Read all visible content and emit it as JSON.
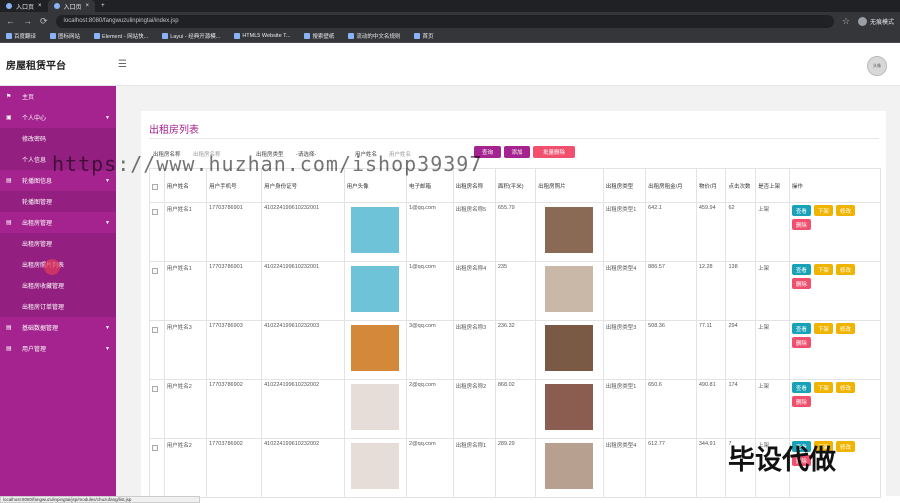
{
  "browser": {
    "tabs": [
      {
        "label": "入口页"
      },
      {
        "label": "入口页"
      }
    ],
    "url": "localhost:8080/fangwuzulinpingtai/index.jsp",
    "profile": "无痕模式",
    "bookmarks": [
      "百度翻译",
      "图标网站",
      "Element - 网站快...",
      "Layui - 经典开源模...",
      "HTML5 Website T...",
      "搜索壁纸",
      "流动的中文名规则",
      "首页"
    ]
  },
  "app": {
    "title": "房屋租赁平台",
    "avatar_label": "头像"
  },
  "sidebar": {
    "items": [
      {
        "label": "主页",
        "children": []
      },
      {
        "label": "个人中心",
        "children": [
          "修改密码",
          "个人信息"
        ]
      },
      {
        "label": "轮播图信息",
        "children": [
          "轮播图管理"
        ]
      },
      {
        "label": "出租房管理",
        "children": [
          "出租房管理",
          "出租房照片列表",
          "出租房收藏管理",
          "出租房订单管理"
        ]
      },
      {
        "label": "基础数据管理",
        "children": []
      },
      {
        "label": "用户管理",
        "children": []
      }
    ]
  },
  "page": {
    "title": "出租房列表"
  },
  "search": {
    "name_label": "出租房名称",
    "name_placeholder": "出租房名称",
    "type_label": "出租房类型",
    "type_value": "-请选择-",
    "user_label": "用户姓名",
    "user_placeholder": "用户姓名",
    "query_btn": "查询",
    "add_btn": "添加",
    "batch_delete_btn": "批量删除"
  },
  "table": {
    "headers": [
      "用户姓名",
      "用户手机号",
      "用户身份证号",
      "用户头像",
      "电子邮箱",
      "出租房名称",
      "面积(平米)",
      "出租房照片",
      "出租房类型",
      "出租房租金/月",
      "物价/月",
      "点击次数",
      "是否上架",
      "操作"
    ],
    "rows": [
      {
        "user": "用户姓名1",
        "phone": "17703786901",
        "idcard": "410224199610232001",
        "email": "1@qq.com",
        "house": "出租房名称5",
        "area": "655.79",
        "type": "出租房类型1",
        "rent": "642.1",
        "price": "459.94",
        "clicks": "62",
        "status": "上架",
        "avatar_color": "#6fc3d8",
        "photo_color": "#8a6a55"
      },
      {
        "user": "用户姓名1",
        "phone": "17703786901",
        "idcard": "410224199610232001",
        "email": "1@qq.com",
        "house": "出租房名称4",
        "area": "235",
        "type": "出租房类型4",
        "rent": "886.57",
        "price": "12.28",
        "clicks": "138",
        "status": "上架",
        "avatar_color": "#6fc3d8",
        "photo_color": "#c9b8a8"
      },
      {
        "user": "用户姓名3",
        "phone": "17703786903",
        "idcard": "410224199610232003",
        "email": "3@qq.com",
        "house": "出租房名称3",
        "area": "236.32",
        "type": "出租房类型3",
        "rent": "508.36",
        "price": "77.11",
        "clicks": "294",
        "status": "上架",
        "avatar_color": "#d4893a",
        "photo_color": "#7a5a45"
      },
      {
        "user": "用户姓名2",
        "phone": "17703786902",
        "idcard": "410224199610232002",
        "email": "2@qq.com",
        "house": "出租房名称2",
        "area": "868.02",
        "type": "出租房类型1",
        "rent": "650.6",
        "price": "490.81",
        "clicks": "174",
        "status": "上架",
        "avatar_color": "#e6dcd8",
        "photo_color": "#8b5c50"
      },
      {
        "user": "用户姓名2",
        "phone": "17703786902",
        "idcard": "410224199610232002",
        "email": "2@qq.com",
        "house": "出租房名称1",
        "area": "289.29",
        "type": "出租房类型4",
        "rent": "612.77",
        "price": "344.91",
        "clicks": "7",
        "status": "上架",
        "avatar_color": "#e6dcd8",
        "photo_color": "#b8a090"
      }
    ],
    "ops": {
      "view": "查看",
      "off": "下架",
      "edit": "修改",
      "delete": "删除"
    }
  },
  "overlay": {
    "watermark": "https://www.huzhan.com/ishop39397",
    "corner_text": "毕设代做"
  },
  "status_url": "localhost:8080/fangwuzulinpingtai/jsp/modules/chuzufang/list.jsp"
}
